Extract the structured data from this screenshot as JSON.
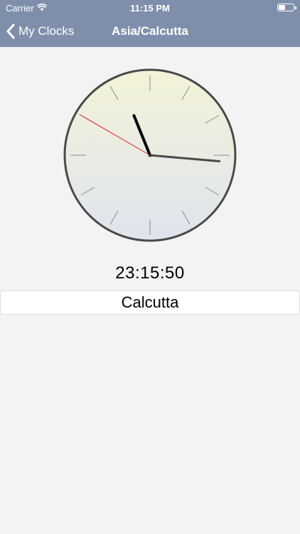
{
  "status_bar": {
    "carrier": "Carrier",
    "time": "11:15 PM",
    "wifi_icon": "wifi-icon",
    "battery_icon": "battery-icon",
    "battery_level": 0.45
  },
  "nav": {
    "back_label": "My Clocks",
    "back_icon": "chevron-left-icon",
    "title": "Asia/Calcutta"
  },
  "clock": {
    "hours": 23,
    "minutes": 15,
    "seconds": 50,
    "colors": {
      "rim": "#4a4a4a",
      "face_top": "#f3f3d8",
      "face_bottom": "#dfe4ee",
      "tick": "#8a8a8a",
      "hour_hand": "#000000",
      "minute_hand": "#4a4a4a",
      "second_hand": "#e0201e"
    }
  },
  "digital_time": "23:15:50",
  "city": "Calcutta"
}
